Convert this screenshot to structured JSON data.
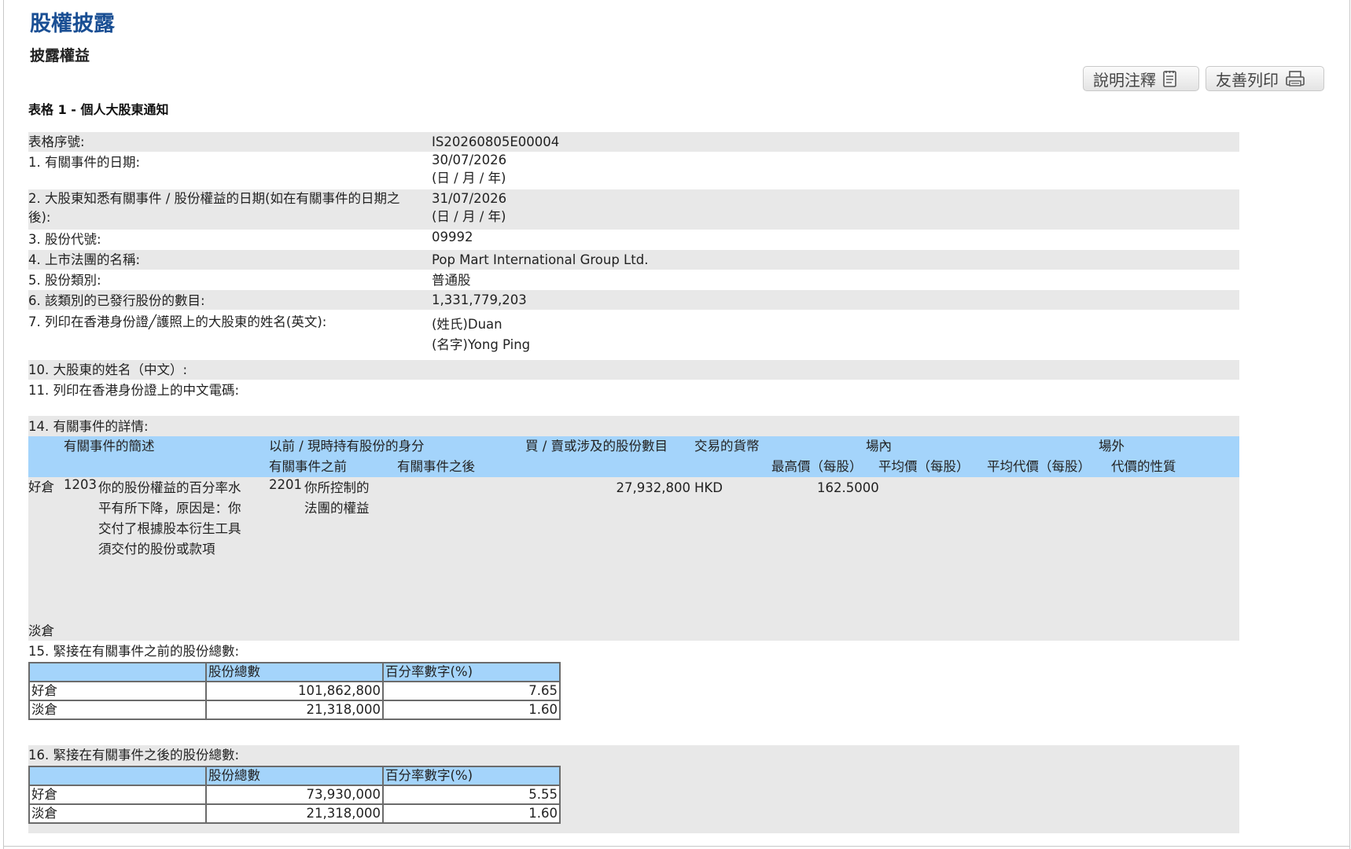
{
  "header": {
    "title": "股權披露",
    "subtitle": "披露權益",
    "buttons": {
      "notes": "說明注釋",
      "print": "友善列印"
    }
  },
  "form": {
    "heading": "表格 1 - 個人大股東通知",
    "fields": [
      {
        "label": "表格序號:",
        "value": "IS20260805E00004"
      },
      {
        "label": "1. 有關事件的日期:",
        "value": "30/07/2026",
        "note": "(日 / 月 / 年)"
      },
      {
        "label": "2. 大股東知悉有關事件 / 股份權益的日期(如在有關事件的日期之",
        "label_cont": "後):",
        "value": "31/07/2026",
        "note": "(日 / 月 / 年)"
      },
      {
        "label": "3. 股份代號:",
        "value": "09992"
      },
      {
        "label": "4. 上市法團的名稱:",
        "value": "Pop Mart International Group Ltd."
      },
      {
        "label": "5. 股份類別:",
        "value": "普通股"
      },
      {
        "label": "6. 該類別的已發行股份的數目:",
        "value": "1,331,779,203"
      },
      {
        "label": "7. 列印在香港身份證╱護照上的大股東的姓名(英文):",
        "surname": "(姓氏)Duan",
        "given_name": "(名字)Yong Ping"
      },
      {
        "label": "10. 大股東的姓名（中文）:"
      },
      {
        "label": "11. 列印在香港身份證上的中文電碼:"
      }
    ]
  },
  "event_details": {
    "section_label": "14. 有關事件的詳情:",
    "headers": {
      "description": "有關事件的簡述",
      "capacity": "以前 / 現時持有股份的身分",
      "before": "有關事件之前",
      "after": "有關事件之後",
      "shares": "買 / 賣或涉及的股份數目",
      "currency": "交易的貨幣",
      "on_exchange": "場內",
      "off_exchange": "場外",
      "highest_price": "最高價（每股）",
      "avg_price": "平均價（每股）",
      "avg_consideration": "平均代價（每股）",
      "consideration_nature": "代價的性質"
    },
    "rows": [
      {
        "position": "好倉",
        "code": "1203",
        "description": "你的股份權益的百分率水平有所下降，原因是：你交付了根據股本衍生工具須交付的股份或款項",
        "capacity_code": "2201",
        "capacity": "你所控制的法團的權益",
        "shares": "27,932,800",
        "currency": "HKD",
        "highest_price": "162.5000"
      },
      {
        "position": "淡倉"
      }
    ]
  },
  "totals_before": {
    "label": "15. 緊接在有關事件之前的股份總數:",
    "col_shares": "股份總數",
    "col_percent": "百分率數字(%)",
    "rows": [
      {
        "position": "好倉",
        "shares": "101,862,800",
        "percent": "7.65"
      },
      {
        "position": "淡倉",
        "shares": "21,318,000",
        "percent": "1.60"
      }
    ]
  },
  "totals_after": {
    "label": "16. 緊接在有關事件之後的股份總數:",
    "col_shares": "股份總數",
    "col_percent": "百分率數字(%)",
    "rows": [
      {
        "position": "好倉",
        "shares": "73,930,000",
        "percent": "5.55"
      },
      {
        "position": "淡倉",
        "shares": "21,318,000",
        "percent": "1.60"
      }
    ]
  },
  "icons": {
    "notes": "document-icon",
    "print": "printer-icon"
  },
  "colors": {
    "title": "#1a4f94",
    "header_band": "#a4d4fb",
    "row_band": "#e8e8e8"
  }
}
